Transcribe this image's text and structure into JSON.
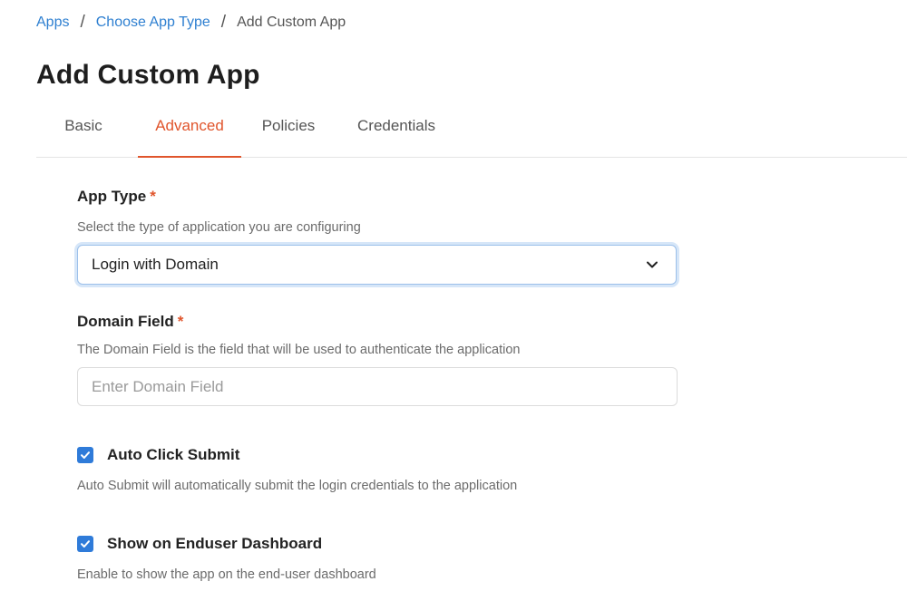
{
  "breadcrumb": {
    "items": [
      "Apps",
      "Choose App Type"
    ],
    "separator": "/",
    "current": "Add Custom App"
  },
  "page": {
    "title": "Add Custom App"
  },
  "tabs": [
    {
      "label": "Basic",
      "active": false
    },
    {
      "label": "Advanced",
      "active": true
    },
    {
      "label": "Policies",
      "active": false
    },
    {
      "label": "Credentials",
      "active": false
    }
  ],
  "form": {
    "app_type": {
      "label": "App Type",
      "required_mark": "*",
      "help": "Select the type of application you are configuring",
      "value": "Login with Domain",
      "icon": "chevron-down-icon"
    },
    "domain_field": {
      "label": "Domain Field",
      "required_mark": "*",
      "help": "The Domain Field is the field that will be used to authenticate the application",
      "placeholder": "Enter Domain Field",
      "value": ""
    },
    "auto_click_submit": {
      "label": "Auto Click Submit",
      "checked": true,
      "help": "Auto Submit will automatically submit the login credentials to the application"
    },
    "show_on_dashboard": {
      "label": "Show on Enduser Dashboard",
      "checked": true,
      "help": "Enable to show the app on the end-user dashboard"
    }
  },
  "colors": {
    "accent": "#e0552c",
    "link": "#2f80d1",
    "checkbox": "#2f7bd9",
    "focus_ring": "#9cc0ea"
  }
}
